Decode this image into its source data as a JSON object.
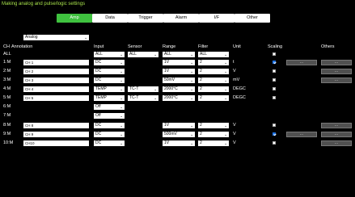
{
  "title": "Making analog and pulse/logic settings",
  "tabs": [
    {
      "label": "Amp",
      "active": true
    },
    {
      "label": "Data",
      "active": false
    },
    {
      "label": "Trigger",
      "active": false
    },
    {
      "label": "Alarm",
      "active": false
    },
    {
      "label": "I/F",
      "active": false
    },
    {
      "label": "Other",
      "active": false
    }
  ],
  "mode_select": "Analog",
  "headers": {
    "ch": "CH",
    "annotation": "Annotation",
    "input": "Input",
    "sensor": "Sensor",
    "range": "Range",
    "filter": "Filter",
    "unit": "Unit",
    "scaling": "Scaling",
    "others": "Others"
  },
  "all_row": {
    "label": "ALL",
    "input": "ALL",
    "sensor": "ALL",
    "range": "ALL",
    "filter": "ALL"
  },
  "rows": [
    {
      "ch": "1:M",
      "annotation": "CH 1",
      "input": "DC",
      "sensor": "",
      "range": "1V",
      "filter": "2",
      "unit": "t",
      "scaling": true,
      "scaling_btn": "...",
      "others_btn": "..."
    },
    {
      "ch": "2:M",
      "annotation": "CH 2",
      "input": "DC",
      "sensor": "",
      "range": "1V",
      "filter": "2",
      "unit": "V",
      "scaling": false,
      "scaling_btn": "",
      "others_btn": "..."
    },
    {
      "ch": "3:M",
      "annotation": "CH 3",
      "input": "DC",
      "sensor": "",
      "range": "50mV",
      "filter": "2",
      "unit": "mV",
      "scaling": false,
      "scaling_btn": "",
      "others_btn": "..."
    },
    {
      "ch": "4:M",
      "annotation": "CH 4",
      "input": "TEMP",
      "sensor": "TC-T",
      "range": "2000°C",
      "filter": "2",
      "unit": "DEGC",
      "scaling": false,
      "scaling_btn": "",
      "others_btn": ""
    },
    {
      "ch": "5:M",
      "annotation": "CH 5",
      "input": "TEMP",
      "sensor": "TC-T",
      "range": "2000°C",
      "filter": "2",
      "unit": "DEGC",
      "scaling": false,
      "scaling_btn": "",
      "others_btn": ""
    },
    {
      "ch": "6:M",
      "annotation": "",
      "input": "Off",
      "sensor": "",
      "range": "",
      "filter": "",
      "unit": "",
      "scaling": null,
      "scaling_btn": "",
      "others_btn": ""
    },
    {
      "ch": "7:M",
      "annotation": "",
      "input": "Off",
      "sensor": "",
      "range": "",
      "filter": "",
      "unit": "",
      "scaling": null,
      "scaling_btn": "",
      "others_btn": ""
    },
    {
      "ch": "8:M",
      "annotation": "CH 8",
      "input": "DC",
      "sensor": "",
      "range": "1V",
      "filter": "2",
      "unit": "V",
      "scaling": false,
      "scaling_btn": "",
      "others_btn": "..."
    },
    {
      "ch": "9:M",
      "annotation": "CH 9",
      "input": "DC",
      "sensor": "",
      "range": "500mV",
      "filter": "2",
      "unit": "V",
      "scaling": true,
      "scaling_btn": "...",
      "others_btn": "..."
    },
    {
      "ch": "10:M",
      "annotation": "CH10",
      "input": "DC",
      "sensor": "",
      "range": "1V",
      "filter": "2",
      "unit": "V",
      "scaling": false,
      "scaling_btn": "",
      "others_btn": "..."
    }
  ],
  "colors": {
    "title": "#a6e04a",
    "active_tab": "#3fc23f",
    "background": "#000000",
    "checkbox_checked": "#1e73e8"
  }
}
